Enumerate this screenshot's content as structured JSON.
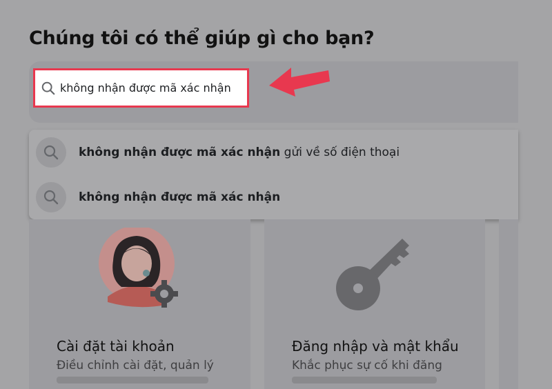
{
  "page": {
    "title": "Chúng tôi có thể giúp gì cho bạn?"
  },
  "search": {
    "value": "không nhận được mã xác nhận",
    "icon": "search-icon",
    "highlight_color": "#e8384f"
  },
  "suggestions": [
    {
      "bold": "không nhận được mã xác nhận",
      "rest": " gửi về số điện thoại",
      "icon": "search-icon"
    },
    {
      "bold": "không nhận được mã xác nhận",
      "rest": "",
      "icon": "search-icon"
    }
  ],
  "cards": [
    {
      "title": "Cài đặt tài khoản",
      "desc": "Điều chỉnh cài đặt, quản lý",
      "icon": "person-settings-icon"
    },
    {
      "title": "Đăng nhập và mật khẩu",
      "desc": "Khắc phục sự cố khi đăng",
      "icon": "key-icon"
    }
  ],
  "colors": {
    "overlay": "#a4a4a6",
    "arrow": "#e8384f"
  }
}
